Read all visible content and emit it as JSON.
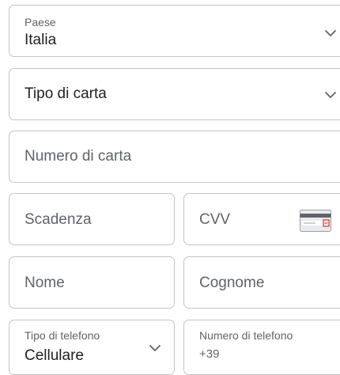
{
  "form": {
    "country": {
      "label": "Paese",
      "value": "Italia",
      "icon": "chevron-down-icon"
    },
    "card_type": {
      "value": "Tipo di carta",
      "icon": "chevron-down-icon"
    },
    "card_number": {
      "placeholder": "Numero di carta"
    },
    "expiry": {
      "placeholder": "Scadenza"
    },
    "cvv": {
      "placeholder": "CVV",
      "icon": "card-cvv-icon"
    },
    "first_name": {
      "placeholder": "Nome"
    },
    "last_name": {
      "placeholder": "Cognome"
    },
    "phone_type": {
      "label": "Tipo di telefono",
      "value": "Cellulare",
      "icon": "chevron-down-icon"
    },
    "phone_number": {
      "label": "Numero di telefono",
      "value": "+39"
    }
  },
  "colors": {
    "border": "#c4c4c4",
    "text": "#202124",
    "muted": "#5f6368",
    "cvv_accent": "#d93025"
  }
}
